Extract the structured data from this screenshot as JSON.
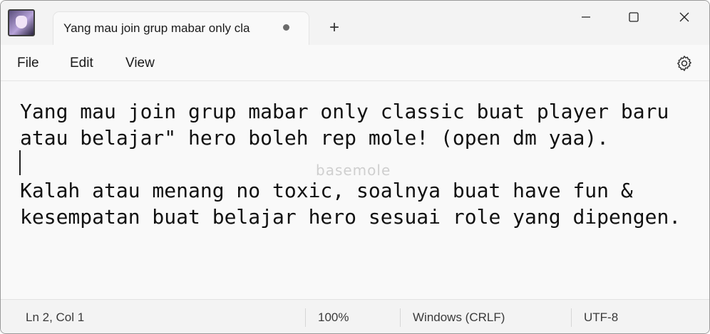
{
  "tab": {
    "title": "Yang mau join grup mabar only cla",
    "new_tab_symbol": "+"
  },
  "menu": {
    "file": "File",
    "edit": "Edit",
    "view": "View"
  },
  "icons": {
    "app": "notepad-app-icon",
    "unsaved": "unsaved-dot-icon",
    "settings": "gear-icon",
    "minimize": "minimize-icon",
    "maximize": "maximize-icon",
    "close": "close-icon"
  },
  "editor": {
    "lines": [
      "Yang mau join grup mabar only classic buat player baru",
      "atau belajar\" hero boleh rep mole! (open dm yaa).",
      "",
      "Kalah atau menang no toxic, soalnya buat have fun &",
      "kesempatan buat belajar hero sesuai role yang dipengen."
    ],
    "watermark": "basemole"
  },
  "status": {
    "position": "Ln 2, Col 1",
    "zoom": "100%",
    "line_ending": "Windows (CRLF)",
    "encoding": "UTF-8"
  },
  "colors": {
    "background": "#f9f9f9",
    "chrome": "#f3f3f3",
    "text": "#111111"
  }
}
